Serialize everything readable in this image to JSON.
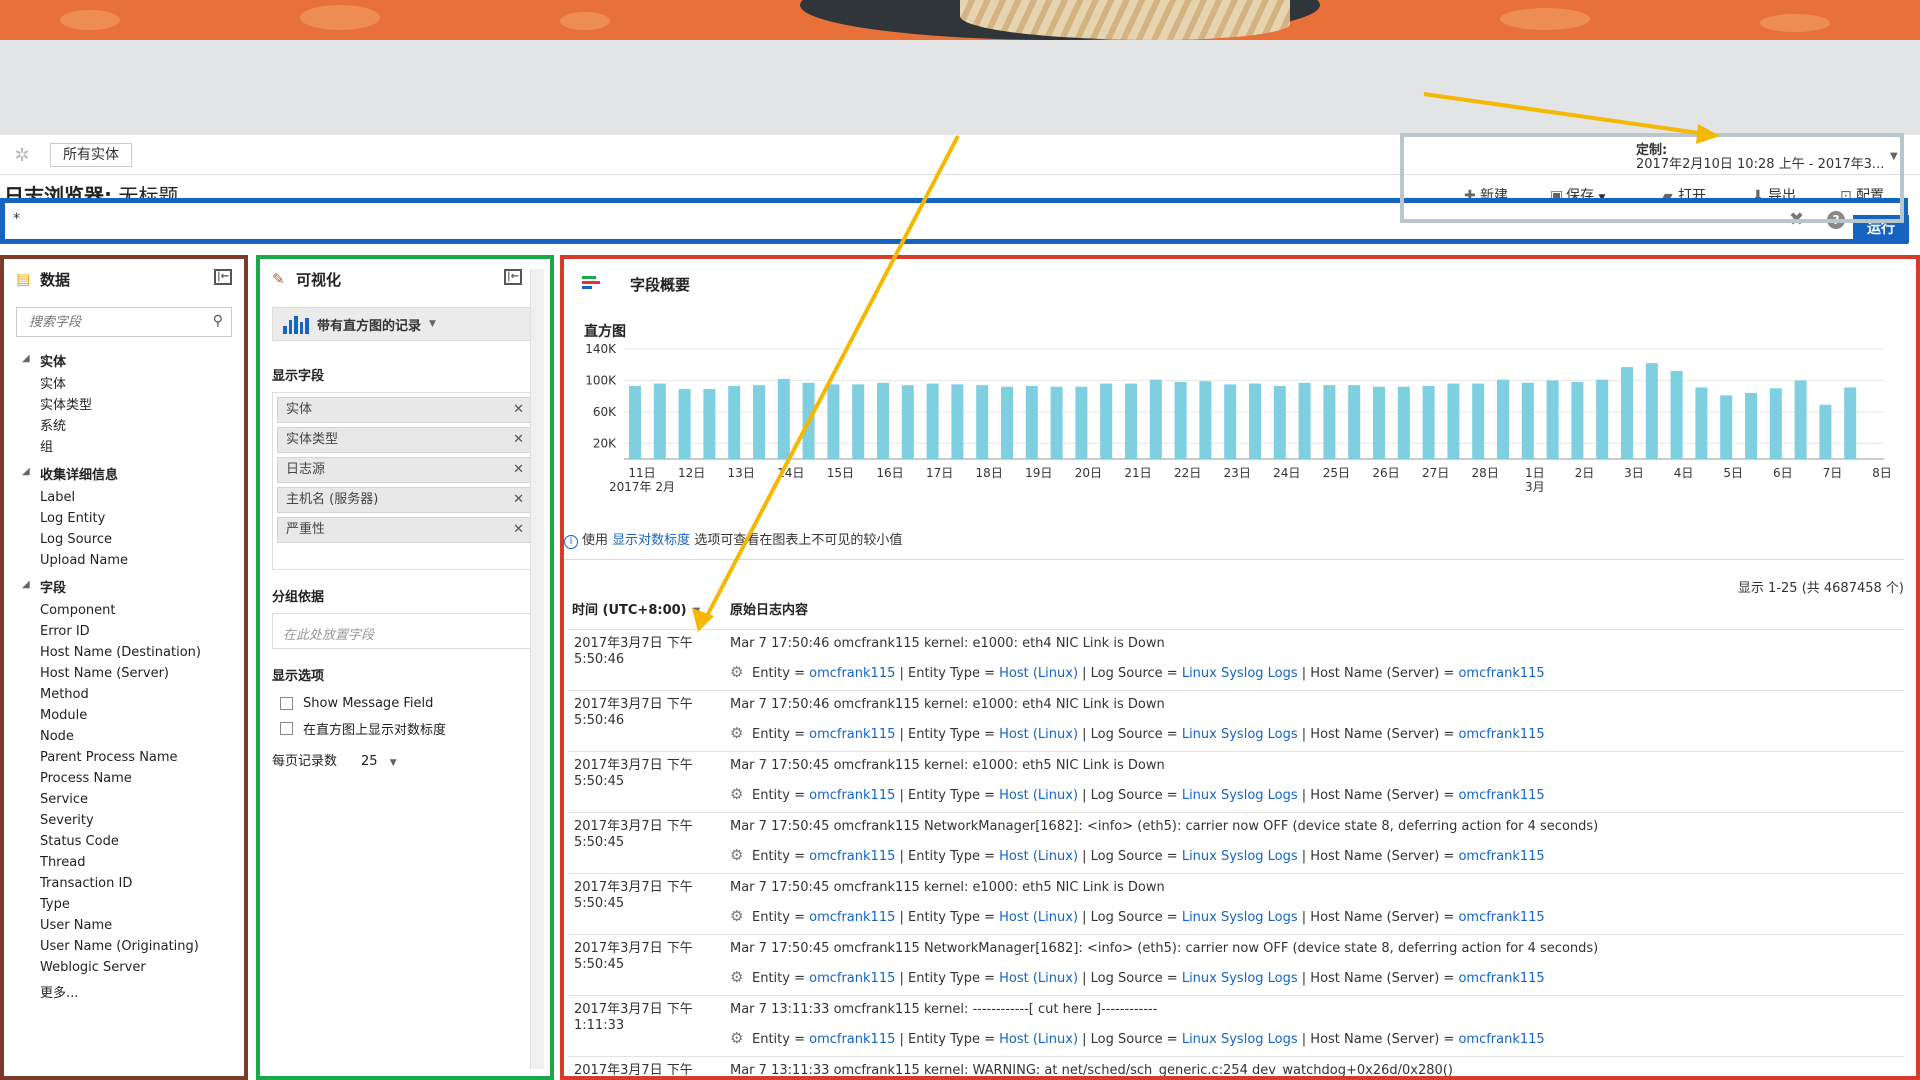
{
  "entity_bar": {
    "entity_tab": "所有实体",
    "time_label": "定制:",
    "time_value": "2017年2月10日 10:28 上午 - 2017年3..."
  },
  "title": {
    "main": "日志浏览器:",
    "sub": " 无标题"
  },
  "toolbar": {
    "new": "新建",
    "save": "保存",
    "open": "打开",
    "export": "导出",
    "config": "配置"
  },
  "query": {
    "text": "*",
    "run": "运行"
  },
  "data_panel": {
    "title": "数据",
    "search_placeholder": "搜索字段",
    "groups": [
      {
        "title": "实体",
        "items": [
          "实体",
          "实体类型",
          "系统",
          "组"
        ]
      },
      {
        "title": "收集详细信息",
        "items": [
          "Label",
          "Log Entity",
          "Log Source",
          "Upload Name"
        ]
      },
      {
        "title": "字段",
        "items": [
          "Component",
          "Error ID",
          "Host Name (Destination)",
          "Host Name (Server)",
          "Method",
          "Module",
          "Node",
          "Parent Process Name",
          "Process Name",
          "Service",
          "Severity",
          "Status Code",
          "Thread",
          "Transaction ID",
          "Type",
          "User Name",
          "User Name (Originating)",
          "Weblogic Server"
        ]
      }
    ],
    "more": "更多..."
  },
  "vis_panel": {
    "title": "可视化",
    "selected": "带有直方图的记录",
    "display_fields_title": "显示字段",
    "display_fields": [
      "实体",
      "实体类型",
      "日志源",
      "主机名 (服务器)",
      "严重性"
    ],
    "group_by_title": "分组依据",
    "group_by_placeholder": "在此处放置字段",
    "options_title": "显示选项",
    "options": [
      "Show Message Field",
      "在直方图上显示对数标度"
    ],
    "per_page_label": "每页记录数",
    "per_page_value": "25"
  },
  "main_panel": {
    "title": "字段概要",
    "histogram_title": "直方图",
    "hint_prefix": "使用",
    "hint_link": "显示对数标度",
    "hint_suffix": "选项可查看在图表上不可见的较小值",
    "showing": "显示 1-25 (共 4687458 个)",
    "col_time": "时间 (UTC+8:00)",
    "col_raw": "原始日志内容",
    "rows": [
      {
        "date": "2017年3月7日 下午",
        "time": "5:50:46",
        "msg": "Mar  7 17:50:46 omcfrank115 kernel: e1000: eth4 NIC Link is Down"
      },
      {
        "date": "2017年3月7日 下午",
        "time": "5:50:46",
        "msg": "Mar  7 17:50:46 omcfrank115 kernel: e1000: eth4 NIC Link is Down"
      },
      {
        "date": "2017年3月7日 下午",
        "time": "5:50:45",
        "msg": "Mar  7 17:50:45 omcfrank115 kernel: e1000: eth5 NIC Link is Down"
      },
      {
        "date": "2017年3月7日 下午",
        "time": "5:50:45",
        "msg": "Mar  7 17:50:45 omcfrank115 NetworkManager[1682]: <info> (eth5): carrier now OFF (device state 8, deferring action for 4 seconds)"
      },
      {
        "date": "2017年3月7日 下午",
        "time": "5:50:45",
        "msg": "Mar  7 17:50:45 omcfrank115 kernel: e1000: eth5 NIC Link is Down"
      },
      {
        "date": "2017年3月7日 下午",
        "time": "5:50:45",
        "msg": "Mar  7 17:50:45 omcfrank115 NetworkManager[1682]: <info> (eth5): carrier now OFF (device state 8, deferring action for 4 seconds)"
      },
      {
        "date": "2017年3月7日 下午",
        "time": "1:11:33",
        "msg": "Mar  7 13:11:33 omcfrank115 kernel: ------------[ cut here ]------------"
      },
      {
        "date": "2017年3月7日 下午",
        "time": "",
        "msg": "Mar  7 13:11:33 omcfrank115 kernel: WARNING: at net/sched/sch_generic.c:254 dev_watchdog+0x26d/0x280()"
      }
    ],
    "meta": {
      "entity_label": "Entity = ",
      "entity": "omcfrank115",
      "entity_type_label": " | Entity Type = ",
      "entity_type": "Host (Linux)",
      "log_source_label": " | Log Source = ",
      "log_source": "Linux Syslog Logs",
      "host_label": " | Host Name (Server) = ",
      "host": "omcfrank115"
    }
  },
  "chart_data": {
    "type": "bar",
    "y_ticks": [
      "140K",
      "100K",
      "60K",
      "20K"
    ],
    "ylim": [
      0,
      140000
    ],
    "x_tick_labels": [
      "11日",
      "12日",
      "13日",
      "14日",
      "15日",
      "16日",
      "17日",
      "18日",
      "19日",
      "20日",
      "21日",
      "22日",
      "23日",
      "24日",
      "25日",
      "26日",
      "27日",
      "28日",
      "1日",
      "2日",
      "3日",
      "4日",
      "5日",
      "6日",
      "7日",
      "8日"
    ],
    "x_sub_labels": [
      {
        "under": "11日",
        "text": "2017年 2月"
      },
      {
        "under": "1日",
        "text": "3月"
      }
    ],
    "values": [
      93000,
      96000,
      89000,
      89000,
      93000,
      94000,
      102000,
      97000,
      95000,
      95000,
      97000,
      94000,
      96000,
      95000,
      94000,
      92000,
      93000,
      92000,
      92000,
      96000,
      96000,
      101000,
      98000,
      99000,
      95000,
      96000,
      93000,
      97000,
      94000,
      94000,
      92000,
      92000,
      93000,
      96000,
      96000,
      101000,
      97000,
      100000,
      98000,
      101000,
      117000,
      122000,
      112000,
      91000,
      81000,
      84000,
      90000,
      100000,
      69000,
      91000
    ],
    "color": "#7ecfe0"
  },
  "colors": {
    "accent": "#1565c0",
    "arrow": "#f5b800",
    "data_panel_border": "#7b3b2b",
    "vis_panel_border": "#1aa84a",
    "main_panel_border": "#d63b2b"
  }
}
